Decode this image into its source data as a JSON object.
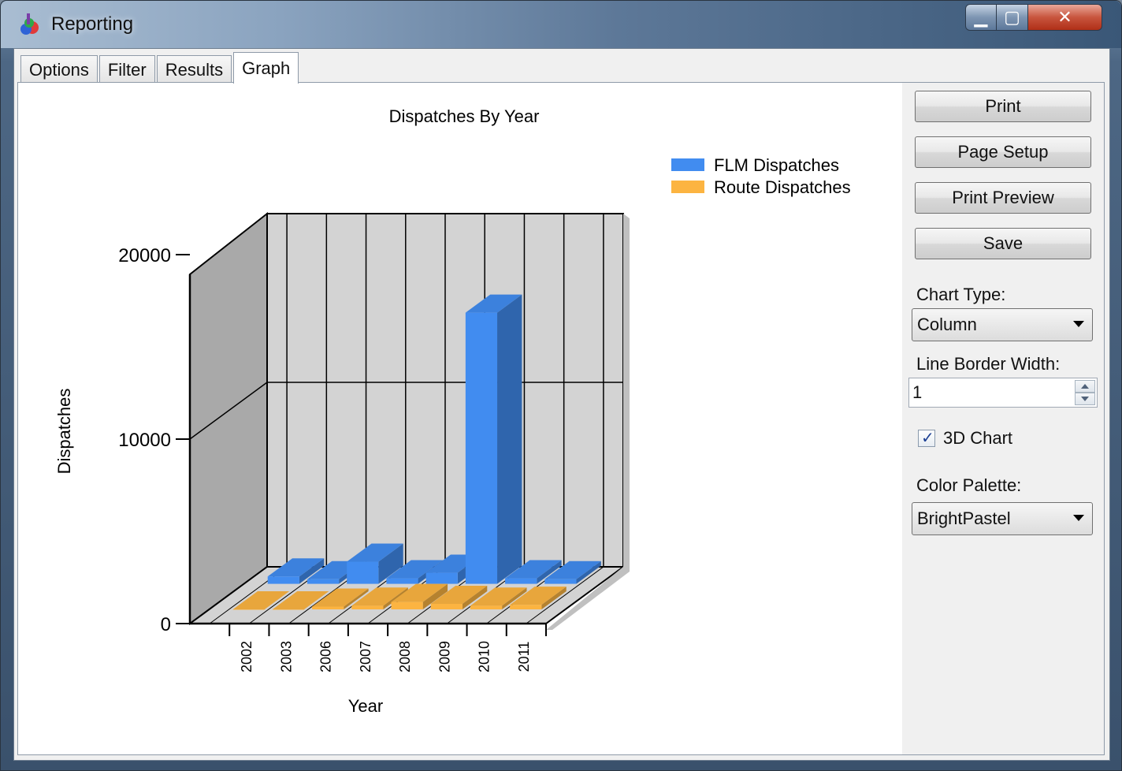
{
  "window": {
    "title": "Reporting",
    "app_icon": "chart-app-icon"
  },
  "tabs": [
    {
      "label": "Options",
      "active": false
    },
    {
      "label": "Filter",
      "active": false
    },
    {
      "label": "Results",
      "active": false
    },
    {
      "label": "Graph",
      "active": true
    }
  ],
  "side_panel": {
    "print_label": "Print",
    "page_setup_label": "Page Setup",
    "print_preview_label": "Print Preview",
    "save_label": "Save",
    "chart_type_label": "Chart Type:",
    "chart_type_value": "Column",
    "line_border_width_label": "Line Border Width:",
    "line_border_width_value": "1",
    "chart_3d_label": "3D Chart",
    "chart_3d_checked": true,
    "color_palette_label": "Color Palette:",
    "color_palette_value": "BrightPastel"
  },
  "chart_data": {
    "type": "bar",
    "title": "Dispatches By Year",
    "xlabel": "Year",
    "ylabel": "Dispatches",
    "ylim": [
      0,
      20000
    ],
    "y_ticks": [
      "0",
      "10000",
      "20000"
    ],
    "categories": [
      "2002",
      "2003",
      "2006",
      "2007",
      "2008",
      "2009",
      "2010",
      "2011"
    ],
    "series": [
      {
        "name": "FLM Dispatches",
        "color": "#418cf0",
        "values": [
          400,
          250,
          1200,
          300,
          600,
          14700,
          300,
          250
        ]
      },
      {
        "name": "Route Dispatches",
        "color": "#fcb441",
        "values": [
          0,
          0,
          150,
          200,
          400,
          300,
          200,
          250
        ]
      }
    ],
    "legend_position": "top-right",
    "three_d": true,
    "grid": true
  }
}
